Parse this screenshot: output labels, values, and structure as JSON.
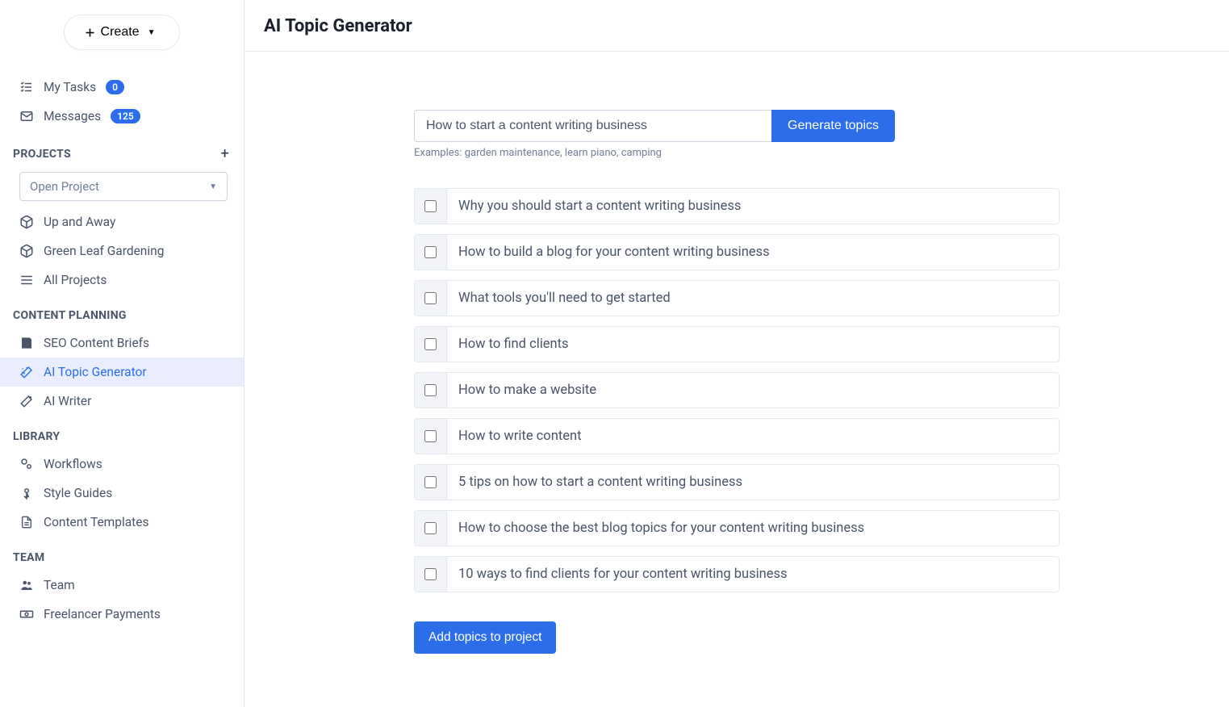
{
  "create_label": "Create",
  "nav_top": {
    "mytasks": {
      "label": "My Tasks",
      "badge": "0"
    },
    "messages": {
      "label": "Messages",
      "badge": "125"
    }
  },
  "sections": {
    "projects": {
      "head": "PROJECTS",
      "open_label": "Open Project",
      "items": [
        "Up and Away",
        "Green Leaf Gardening",
        "All Projects"
      ]
    },
    "content_planning": {
      "head": "CONTENT PLANNING",
      "items": [
        "SEO Content Briefs",
        "AI Topic Generator",
        "AI Writer"
      ],
      "active_index": 1
    },
    "library": {
      "head": "LIBRARY",
      "items": [
        "Workflows",
        "Style Guides",
        "Content Templates"
      ]
    },
    "team": {
      "head": "TEAM",
      "items": [
        "Team",
        "Freelancer Payments"
      ]
    }
  },
  "page": {
    "title": "AI Topic Generator",
    "input_value": "How to start a content writing business",
    "generate_label": "Generate topics",
    "examples": "Examples: garden maintenance, learn piano, camping",
    "topics": [
      "Why you should start a content writing business",
      "How to build a blog for your content writing business",
      "What tools you'll need to get started",
      "How to find clients",
      "How to make a website",
      "How to write content",
      "5 tips on how to start a content writing business",
      "How to choose the best blog topics for your content writing business",
      "10 ways to find clients for your content writing business"
    ],
    "add_label": "Add topics to project"
  }
}
